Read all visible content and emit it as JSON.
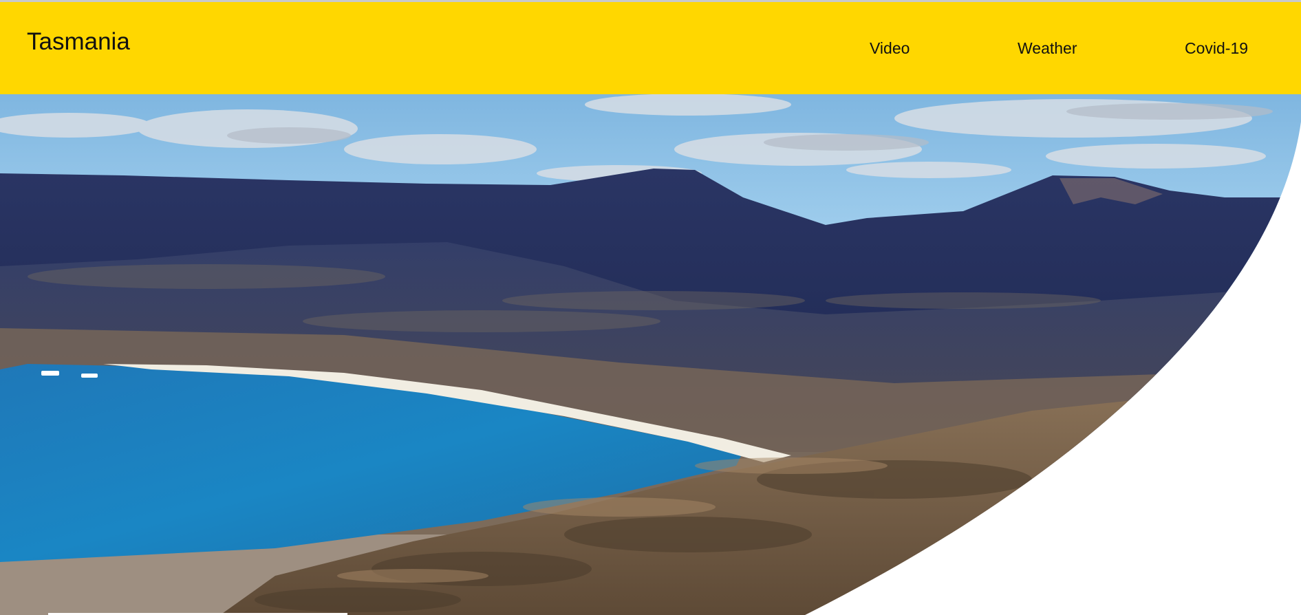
{
  "header": {
    "title": "Tasmania",
    "background_color": "#ffd700"
  },
  "nav": {
    "items": [
      {
        "label": "Video"
      },
      {
        "label": "Weather"
      },
      {
        "label": "Covid-19"
      }
    ]
  },
  "hero": {
    "image": "landscape-photo",
    "scene": "mountains-bay-beach"
  }
}
